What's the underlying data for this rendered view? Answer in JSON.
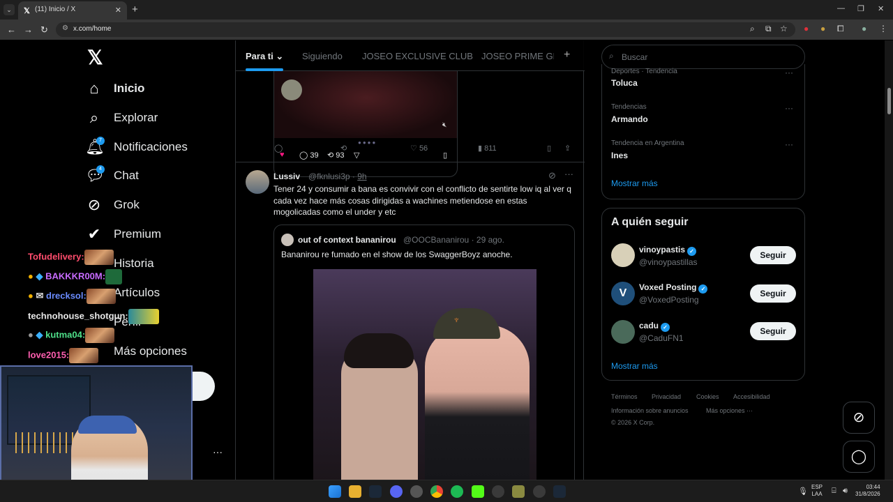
{
  "browser": {
    "tab_title": "(11) Inicio / X",
    "tab_close": "✕",
    "new_tab": "+",
    "url": "x.com/home",
    "window_controls": [
      "—",
      "❐",
      "✕"
    ]
  },
  "sidebar": {
    "logo": "𝕏",
    "items": [
      {
        "label": "Inicio",
        "icon": "home-icon",
        "glyph": "⌂",
        "badge": ""
      },
      {
        "label": "Explorar",
        "icon": "search-icon",
        "glyph": "⌕",
        "badge": ""
      },
      {
        "label": "Notificaciones",
        "icon": "bell-icon",
        "glyph": "🔔︎",
        "badge": "7"
      },
      {
        "label": "Chat",
        "icon": "chat-icon",
        "glyph": "💬︎",
        "badge": "4"
      },
      {
        "label": "Grok",
        "icon": "grok-icon",
        "glyph": "⊘",
        "badge": ""
      },
      {
        "label": "Premium",
        "icon": "premium-icon",
        "glyph": "✔",
        "badge": ""
      },
      {
        "label": "Historia",
        "icon": "bookmark-icon",
        "glyph": "",
        "badge": ""
      },
      {
        "label": "Artículos",
        "icon": "article-icon",
        "glyph": "",
        "badge": ""
      },
      {
        "label": "Perfil",
        "icon": "profile-icon",
        "glyph": "",
        "badge": ""
      },
      {
        "label": "Más opciones",
        "icon": "more-icon",
        "glyph": "",
        "badge": ""
      }
    ],
    "more_dots": "···"
  },
  "stream_chat": [
    {
      "user": "Tofudelivery:",
      "color": "#ff4d6d"
    },
    {
      "user": "BAKKKR00M:",
      "color": "#c86bff"
    },
    {
      "user": "drecksol:",
      "color": "#6b8cff"
    },
    {
      "user": "technohouse_shotgun:",
      "color": "#e8e8e8"
    },
    {
      "user": "kutma04:",
      "color": "#4fe08a"
    },
    {
      "user": "love2015:",
      "color": "#ff5fb0"
    }
  ],
  "feed": {
    "tabs": [
      "Para ti",
      "Siguiendo",
      "JOSEO EXCLUSIVE CLUB",
      "JOSEO PRIME GRI"
    ],
    "embed": {
      "replies": "39",
      "reposts": "93"
    },
    "prev_actions": {
      "likes": "56",
      "views": "811"
    },
    "tweet": {
      "name": "Lussiv",
      "handle": "@fknlusi3p",
      "time": "9h",
      "text": "Tener 24 y consumir a bana es convivir con el conflicto de sentirte low iq al ver q cada vez hace más cosas dirigidas a wachines metiendose en estas mogolicadas como el under y etc",
      "quote": {
        "name": "out of context bananirou",
        "handle": "@OOCBananirou",
        "time": "29 ago.",
        "text": "Bananirou re fumado en el show de los SwaggerBoyz anoche."
      }
    }
  },
  "right": {
    "search_placeholder": "Buscar",
    "trends": [
      {
        "context": "Deportes · Tendencia",
        "title": "Toluca"
      },
      {
        "context": "Tendencias",
        "title": "Armando"
      },
      {
        "context": "Tendencia en Argentina",
        "title": "Ines"
      }
    ],
    "show_more": "Mostrar más",
    "who_title": "A quién seguir",
    "who": [
      {
        "name": "vinoypastis",
        "handle": "@vinoypastillas",
        "follow": "Seguir",
        "avatar_color": "#d8d0b8"
      },
      {
        "name": "Voxed Posting",
        "handle": "@VoxedPosting",
        "follow": "Seguir",
        "avatar_color": "#1f4f7a",
        "avatar_letter": "V"
      },
      {
        "name": "cadu",
        "handle": "@CaduFN1",
        "follow": "Seguir",
        "avatar_color": "#4a6a5a"
      }
    ],
    "who_more": "Mostrar más",
    "footer": [
      "Términos",
      "Privacidad",
      "Cookies",
      "Accesibilidad",
      "Información sobre anuncios",
      "Más opciones ···",
      "© 2026 X Corp."
    ]
  },
  "taskbar": {
    "lang": "ESP",
    "lang2": "LAA",
    "time": "03:44",
    "date": "31/8/2026"
  }
}
